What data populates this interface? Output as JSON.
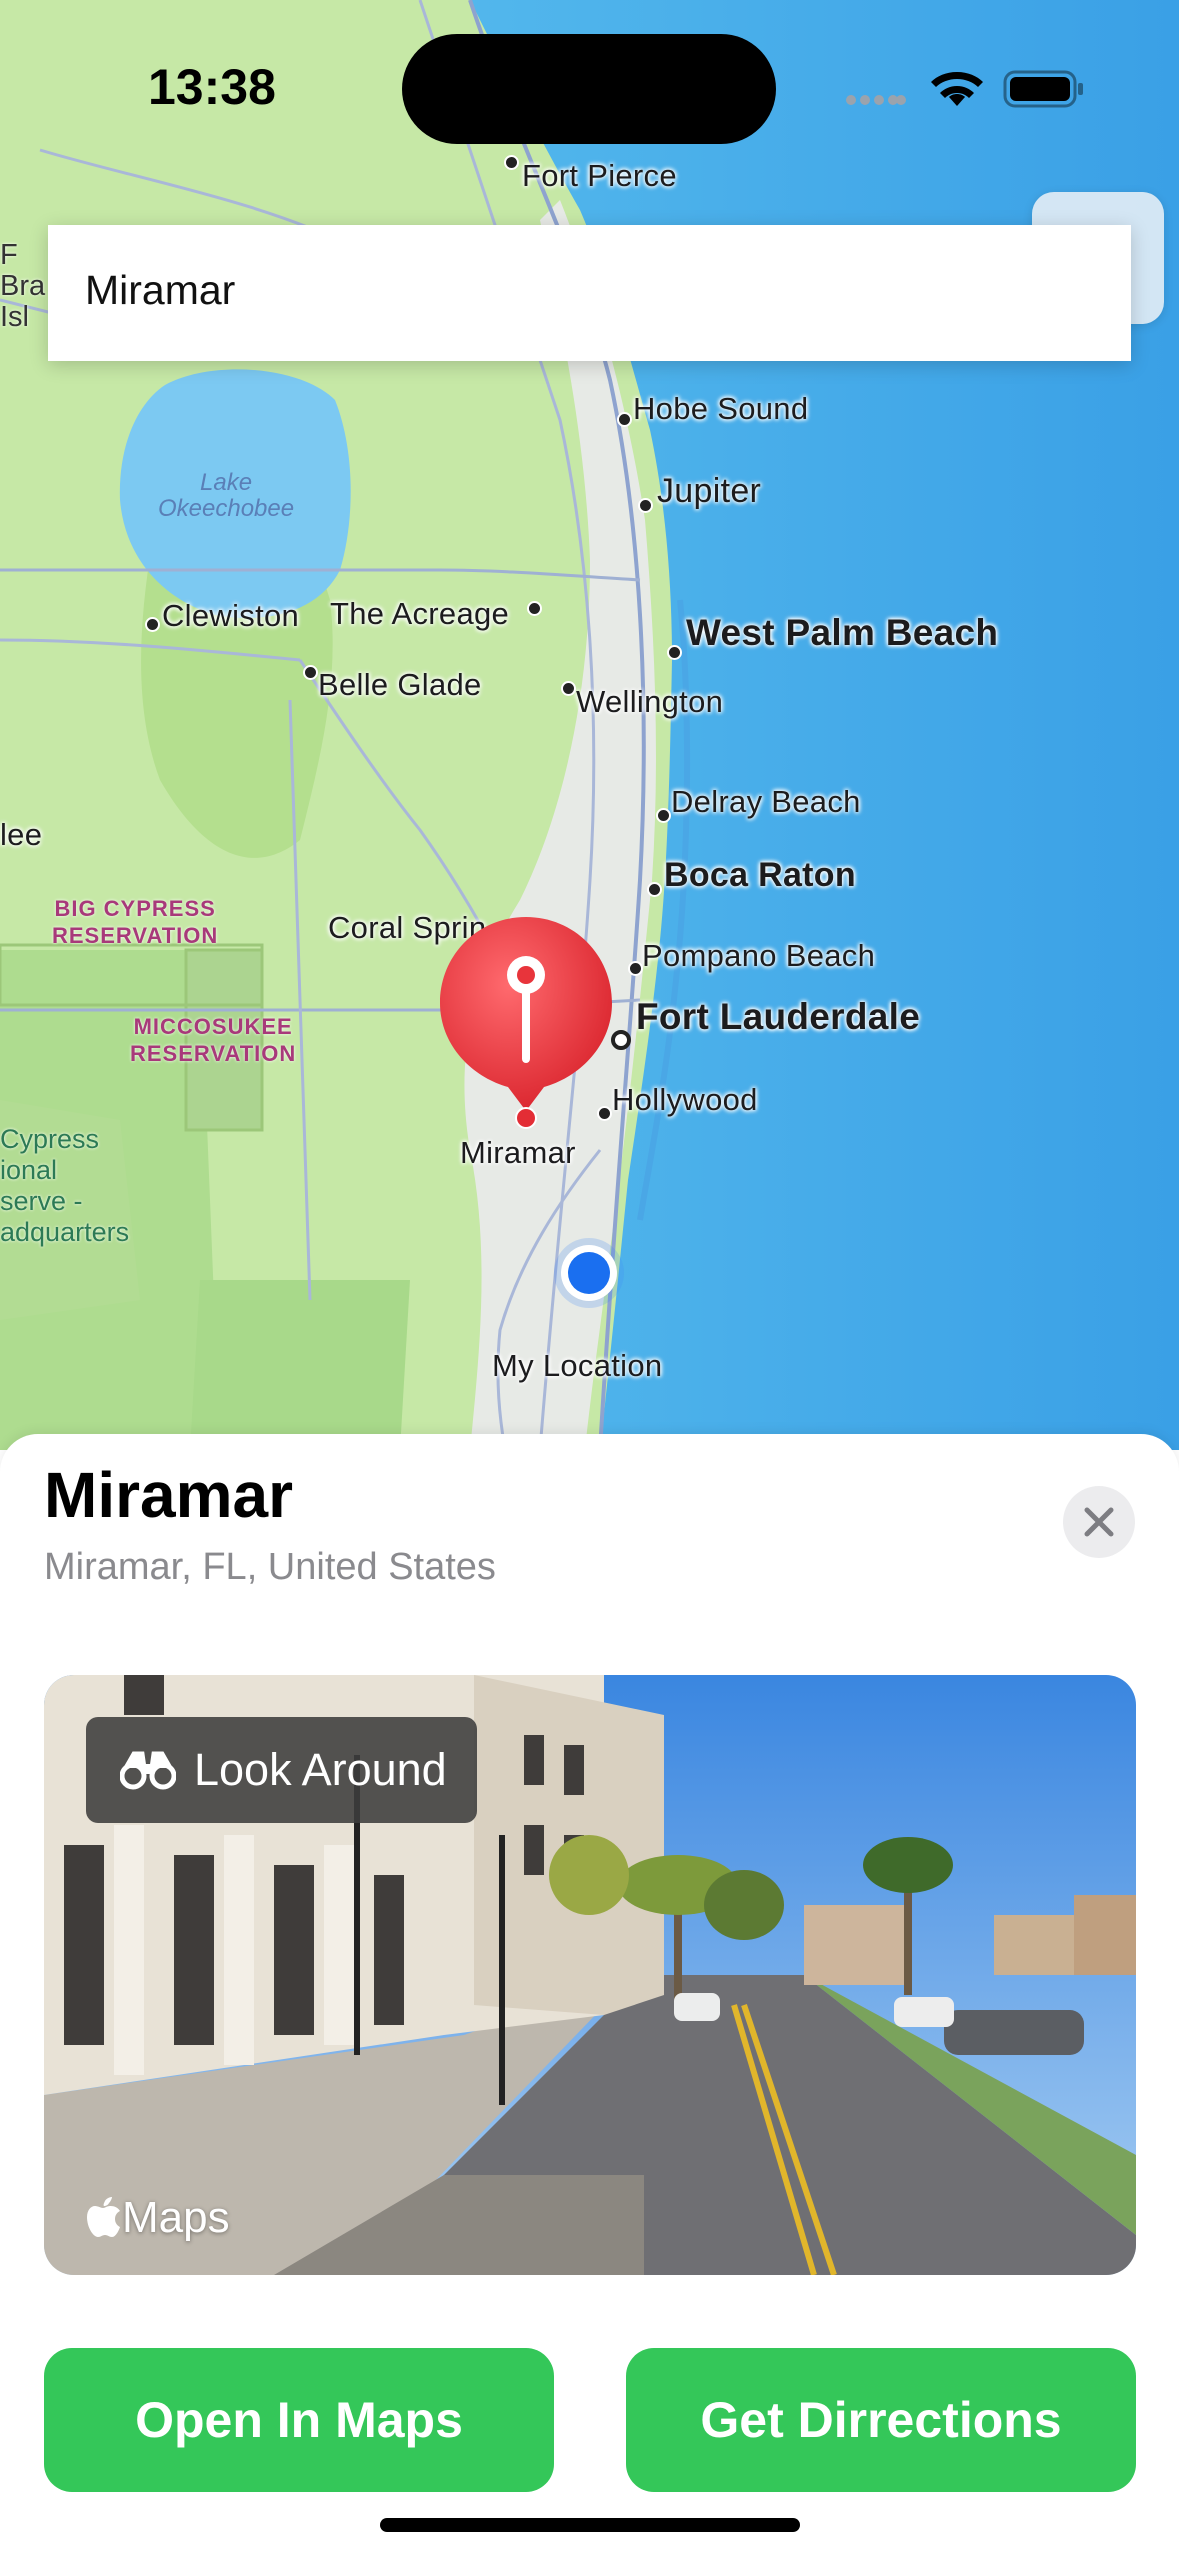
{
  "status_bar": {
    "time": "13:38"
  },
  "search": {
    "value": "Miramar"
  },
  "map": {
    "cities": [
      {
        "label": "Fort Pierce"
      },
      {
        "label": "Hobe Sound"
      },
      {
        "label": "Jupiter"
      },
      {
        "label": "Clewiston"
      },
      {
        "label": "The Acreage"
      },
      {
        "label": "West Palm Beach"
      },
      {
        "label": "Belle Glade"
      },
      {
        "label": "Wellington"
      },
      {
        "label": "Delray Beach"
      },
      {
        "label": "Boca Raton"
      },
      {
        "label": "Coral Sprin"
      },
      {
        "label": "Pompano Beach"
      },
      {
        "label": "Fort Lauderdale"
      },
      {
        "label": "Hollywood"
      },
      {
        "label": "Miramar"
      },
      {
        "label": "My Location"
      },
      {
        "label": "lee"
      }
    ],
    "lake_label": "Lake\nOkeechobee",
    "parks": [
      {
        "label": "BIG CYPRESS\nRESERVATION"
      },
      {
        "label": "MICCOSUKEE\nRESERVATION"
      }
    ],
    "preserve_label": "Cypress\nional\nserve -\nadquarters",
    "clipped_label": "F\nBra\nIsl"
  },
  "place": {
    "title": "Miramar",
    "subtitle": "Miramar, FL, United States"
  },
  "look_around": {
    "badge": "Look Around",
    "brand": "Maps"
  },
  "buttons": {
    "open_in_maps": "Open In Maps",
    "get_directions": "Get Dirrections"
  },
  "colors": {
    "green": "#34c759",
    "pin_red": "#e8343b",
    "location_blue": "#1a6ff0",
    "water": "#58b4ee",
    "land": "#c7e9a8"
  }
}
